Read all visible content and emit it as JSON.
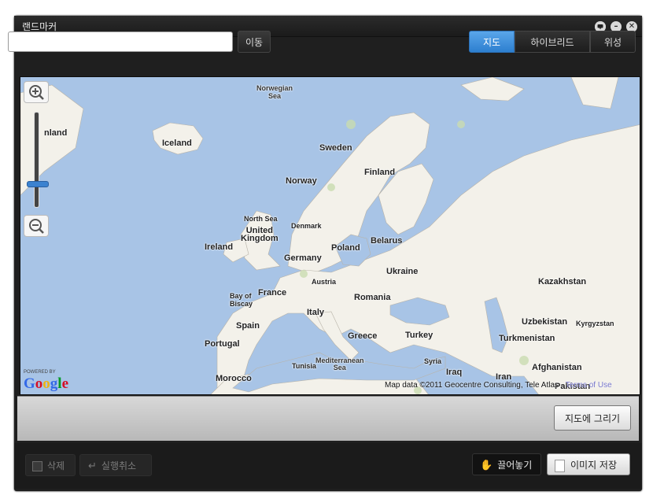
{
  "window": {
    "title": "랜드마커"
  },
  "titlebar": {
    "feedback_icon": "speech-bubble-icon",
    "minimize_label": "–",
    "close_label": "✕"
  },
  "toolbar": {
    "search_value": "",
    "go_label": "이동",
    "map_tabs": [
      {
        "label": "지도",
        "active": true
      },
      {
        "label": "하이브리드",
        "active": false
      },
      {
        "label": "위성",
        "active": false
      }
    ]
  },
  "map": {
    "labels": {
      "norwegian_sea": "Norwegian\nSea",
      "greenland": "nland",
      "iceland": "Iceland",
      "sweden": "Sweden",
      "finland": "Finland",
      "norway": "Norway",
      "north_sea": "North Sea",
      "united_kingdom": "United\nKingdom",
      "denmark": "Denmark",
      "ireland": "Ireland",
      "belarus": "Belarus",
      "poland": "Poland",
      "germany": "Germany",
      "ukraine": "Ukraine",
      "kazakhstan": "Kazakhstan",
      "austria": "Austria",
      "bay_of_biscay": "Bay of\nBiscay",
      "france": "France",
      "romania": "Romania",
      "italy": "Italy",
      "spain": "Spain",
      "uzbekistan": "Uzbekistan",
      "kyrgyzstan": "Kyrgyzstan",
      "portugal": "Portugal",
      "greece": "Greece",
      "turkey": "Turkey",
      "turkmenistan": "Turkmenistan",
      "tunisia": "Tunisia",
      "mediterranean_sea": "Mediterranean\nSea",
      "syria": "Syria",
      "afghanistan": "Afghanistan",
      "iraq": "Iraq",
      "iran": "Iran",
      "morocco": "Morocco",
      "pakistan": "Pakistan"
    },
    "powered_by": "POWERED BY",
    "copyright": "Map data ©2011  Geocentre Consulting, Tele Atlas - ",
    "terms": "Terms of Use",
    "zoom_level": 0.75
  },
  "panel": {
    "draw_on_map_label": "지도에 그리기"
  },
  "footer": {
    "delete_label": "삭제",
    "undo_label": "실행취소",
    "paste_label": "끌어놓기",
    "save_image_label": "이미지 저장"
  },
  "colors": {
    "accent": "#3b86d6",
    "water": "#a8c4e6",
    "land": "#f2efe9"
  }
}
